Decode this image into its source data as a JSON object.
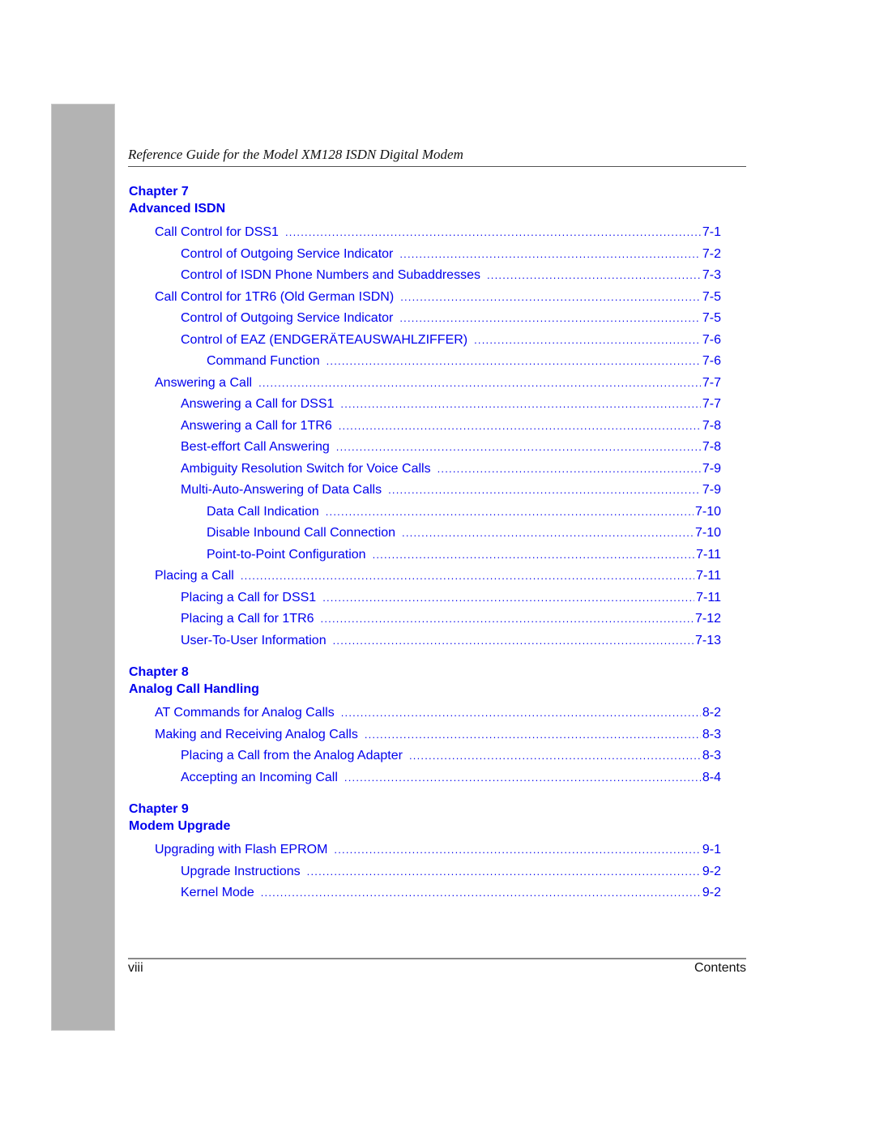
{
  "header": {
    "title": "Reference Guide for the Model XM128 ISDN Digital Modem"
  },
  "chapters": [
    {
      "number_label": "Chapter 7",
      "title": "Advanced ISDN",
      "entries": [
        {
          "label": "Call Control for DSS1",
          "page": "7-1",
          "level": 1
        },
        {
          "label": "Control of Outgoing Service Indicator",
          "page": "7-2",
          "level": 2
        },
        {
          "label": "Control of ISDN Phone Numbers and Subaddresses",
          "page": "7-3",
          "level": 2
        },
        {
          "label": "Call Control for 1TR6 (Old German ISDN)",
          "page": "7-5",
          "level": 1
        },
        {
          "label": "Control of Outgoing Service Indicator",
          "page": "7-5",
          "level": 2
        },
        {
          "label": "Control of EAZ (ENDGERÄTEAUSWAHLZIFFER)",
          "page": "7-6",
          "level": 2
        },
        {
          "label": "Command Function",
          "page": "7-6",
          "level": 3
        },
        {
          "label": "Answering a Call",
          "page": "7-7",
          "level": 1
        },
        {
          "label": "Answering a Call for DSS1",
          "page": "7-7",
          "level": 2
        },
        {
          "label": "Answering a Call for 1TR6",
          "page": "7-8",
          "level": 2
        },
        {
          "label": "Best-effort Call Answering",
          "page": "7-8",
          "level": 2
        },
        {
          "label": "Ambiguity Resolution Switch for Voice Calls",
          "page": "7-9",
          "level": 2
        },
        {
          "label": "Multi-Auto-Answering of Data Calls",
          "page": "7-9",
          "level": 2
        },
        {
          "label": "Data Call Indication",
          "page": "7-10",
          "level": 3
        },
        {
          "label": "Disable Inbound Call Connection",
          "page": "7-10",
          "level": 3
        },
        {
          "label": "Point-to-Point Configuration",
          "page": "7-11",
          "level": 3
        },
        {
          "label": "Placing a Call",
          "page": "7-11",
          "level": 1
        },
        {
          "label": "Placing a Call for DSS1",
          "page": "7-11",
          "level": 2
        },
        {
          "label": "Placing a Call for 1TR6",
          "page": "7-12",
          "level": 2
        },
        {
          "label": "User-To-User Information",
          "page": "7-13",
          "level": 2
        }
      ]
    },
    {
      "number_label": "Chapter 8",
      "title": "Analog Call Handling",
      "entries": [
        {
          "label": "AT Commands for Analog Calls",
          "page": "8-2",
          "level": 1
        },
        {
          "label": "Making and Receiving Analog Calls",
          "page": "8-3",
          "level": 1
        },
        {
          "label": "Placing a Call from the Analog Adapter",
          "page": "8-3",
          "level": 2
        },
        {
          "label": "Accepting an Incoming Call",
          "page": "8-4",
          "level": 2
        }
      ]
    },
    {
      "number_label": "Chapter 9",
      "title": "Modem Upgrade",
      "entries": [
        {
          "label": "Upgrading with Flash EPROM",
          "page": "9-1",
          "level": 1
        },
        {
          "label": "Upgrade Instructions",
          "page": "9-2",
          "level": 2
        },
        {
          "label": "Kernel Mode",
          "page": "9-2",
          "level": 2
        }
      ]
    }
  ],
  "footer": {
    "page_number": "viii",
    "section": "Contents"
  },
  "colors": {
    "link": "#0000ee",
    "side_tab": "#b3b3b3"
  }
}
